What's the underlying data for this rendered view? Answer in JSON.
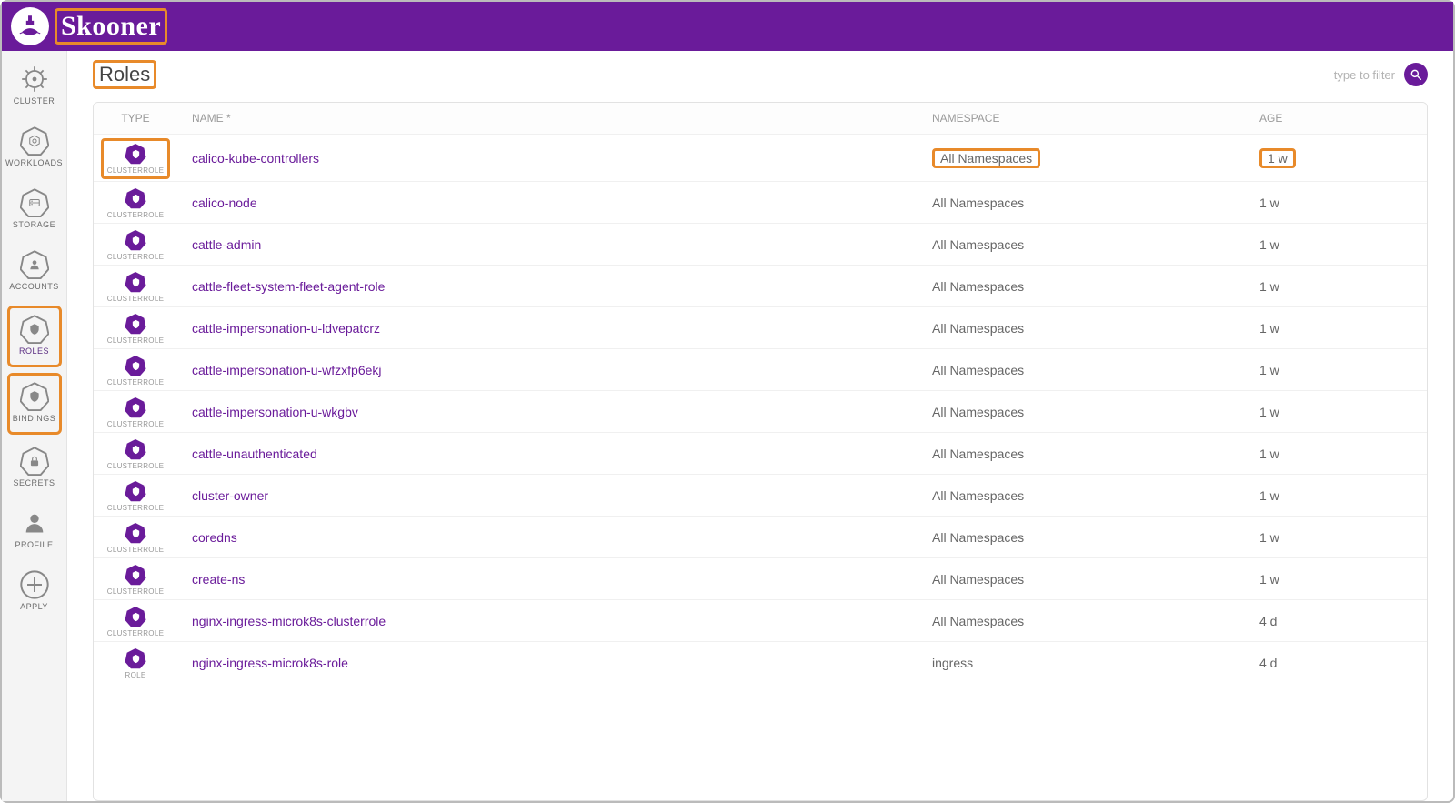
{
  "brand": "Skooner",
  "page_title": "Roles",
  "search_placeholder": "type to filter",
  "sidebar": [
    {
      "label": "CLUSTER",
      "icon": "helm",
      "name": "cluster"
    },
    {
      "label": "WORKLOADS",
      "icon": "hex-nut",
      "name": "workloads"
    },
    {
      "label": "STORAGE",
      "icon": "storage",
      "name": "storage"
    },
    {
      "label": "ACCOUNTS",
      "icon": "hex-user",
      "name": "accounts"
    },
    {
      "label": "ROLES",
      "icon": "hex-shield",
      "name": "roles",
      "active": true,
      "outlined": true
    },
    {
      "label": "BINDINGS",
      "icon": "hex-shield-bind",
      "name": "bindings",
      "outlined": true
    },
    {
      "label": "SECRETS",
      "icon": "hex-lock",
      "name": "secrets"
    },
    {
      "label": "PROFILE",
      "icon": "profile",
      "name": "profile"
    },
    {
      "label": "APPLY",
      "icon": "plus",
      "name": "apply"
    }
  ],
  "columns": {
    "type": "TYPE",
    "name": "NAME *",
    "namespace": "NAMESPACE",
    "age": "AGE"
  },
  "rows": [
    {
      "type": "CLUSTERROLE",
      "name": "calico-kube-controllers",
      "namespace": "All Namespaces",
      "age": "1 w",
      "type_outlined": true,
      "ns_outlined": true,
      "age_outlined": true
    },
    {
      "type": "CLUSTERROLE",
      "name": "calico-node",
      "namespace": "All Namespaces",
      "age": "1 w"
    },
    {
      "type": "CLUSTERROLE",
      "name": "cattle-admin",
      "namespace": "All Namespaces",
      "age": "1 w"
    },
    {
      "type": "CLUSTERROLE",
      "name": "cattle-fleet-system-fleet-agent-role",
      "namespace": "All Namespaces",
      "age": "1 w"
    },
    {
      "type": "CLUSTERROLE",
      "name": "cattle-impersonation-u-ldvepatcrz",
      "namespace": "All Namespaces",
      "age": "1 w"
    },
    {
      "type": "CLUSTERROLE",
      "name": "cattle-impersonation-u-wfzxfp6ekj",
      "namespace": "All Namespaces",
      "age": "1 w"
    },
    {
      "type": "CLUSTERROLE",
      "name": "cattle-impersonation-u-wkgbv",
      "namespace": "All Namespaces",
      "age": "1 w"
    },
    {
      "type": "CLUSTERROLE",
      "name": "cattle-unauthenticated",
      "namespace": "All Namespaces",
      "age": "1 w"
    },
    {
      "type": "CLUSTERROLE",
      "name": "cluster-owner",
      "namespace": "All Namespaces",
      "age": "1 w"
    },
    {
      "type": "CLUSTERROLE",
      "name": "coredns",
      "namespace": "All Namespaces",
      "age": "1 w"
    },
    {
      "type": "CLUSTERROLE",
      "name": "create-ns",
      "namespace": "All Namespaces",
      "age": "1 w"
    },
    {
      "type": "CLUSTERROLE",
      "name": "nginx-ingress-microk8s-clusterrole",
      "namespace": "All Namespaces",
      "age": "4 d"
    },
    {
      "type": "ROLE",
      "name": "nginx-ingress-microk8s-role",
      "namespace": "ingress",
      "age": "4 d"
    }
  ]
}
